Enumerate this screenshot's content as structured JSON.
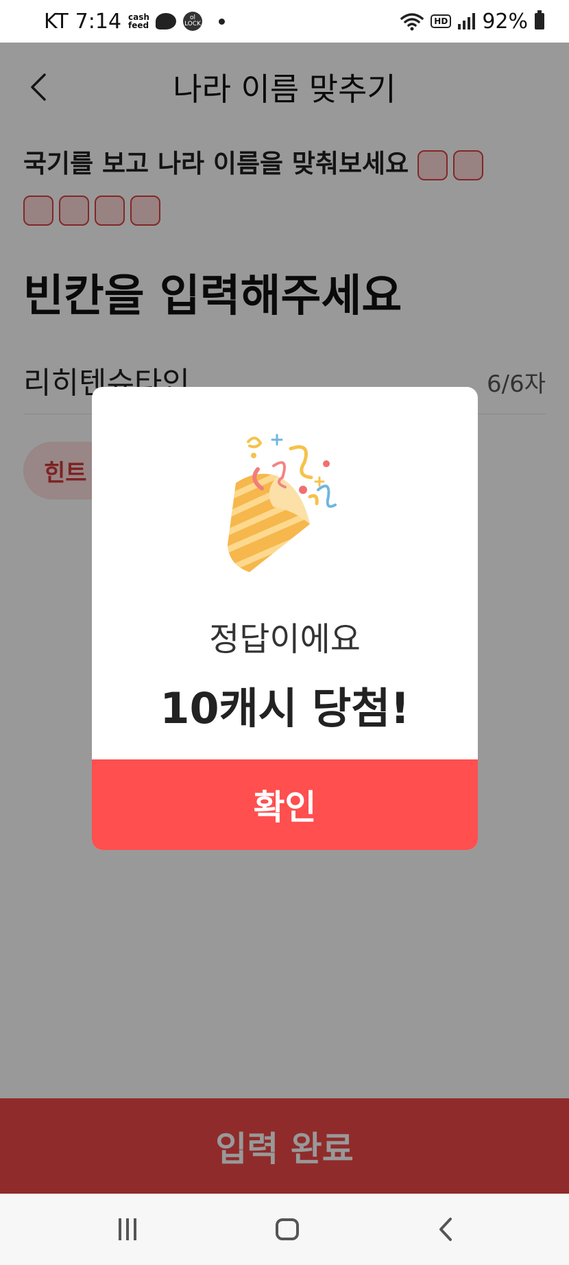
{
  "status_bar": {
    "carrier": "KT",
    "time": "7:14",
    "cashfeed_label": "cash feed",
    "lock_label": "ol LOCK",
    "hd_label": "HD",
    "battery": "92%"
  },
  "header": {
    "title": "나라 이름 맞추기"
  },
  "question": {
    "text": "국기를 보고 나라 이름을 맞춰보세요",
    "blank_count": 6
  },
  "instruction": "빈칸을 입력해주세요",
  "answer": {
    "value": "리히텐슈타인",
    "count": "6/6자"
  },
  "hint_label": "힌트",
  "submit_label": "입력 완료",
  "modal": {
    "message": "정답이에요",
    "reward": "10캐시 당첨!",
    "confirm_label": "확인"
  },
  "colors": {
    "accent": "#ff4f4f",
    "blank_border": "#d94444"
  },
  "icons": {
    "back": "chevron-left-icon",
    "celebration": "party-popper-icon",
    "nav_recent": "recent-apps-icon",
    "nav_home": "home-icon",
    "nav_back": "back-icon"
  }
}
